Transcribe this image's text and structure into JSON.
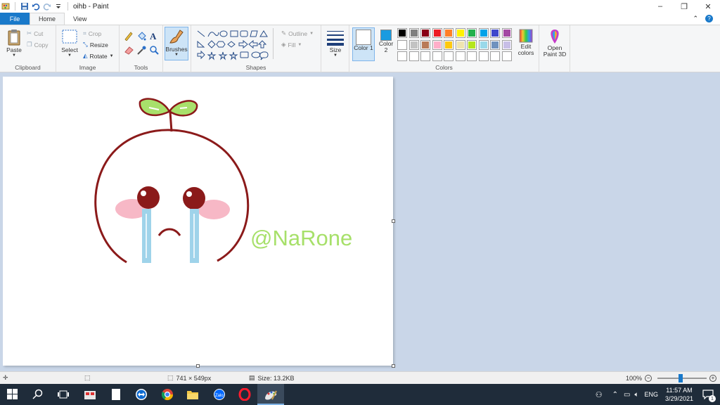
{
  "window": {
    "title": "oihb - Paint",
    "controls": {
      "minimize": "–",
      "restore": "❐",
      "close": "✕"
    }
  },
  "tabs": [
    {
      "label": "File"
    },
    {
      "label": "Home"
    },
    {
      "label": "View"
    }
  ],
  "ribbon_right": {
    "collapse": "⌃",
    "help": "?"
  },
  "clipboard": {
    "paste": "Paste",
    "cut": "Cut",
    "copy": "Copy",
    "label": "Clipboard"
  },
  "image": {
    "select": "Select",
    "crop": "Crop",
    "resize": "Resize",
    "rotate": "Rotate",
    "label": "Image"
  },
  "tools": {
    "label": "Tools"
  },
  "brushes": {
    "label": "Brushes"
  },
  "shapes": {
    "outline": "Outline",
    "fill": "Fill",
    "label": "Shapes"
  },
  "size": {
    "label": "Size"
  },
  "colors": {
    "color1": "Color 1",
    "color2": "Color 2",
    "edit": "Edit colors",
    "label": "Colors",
    "color1_value": "#ffffff",
    "color2_value": "#1a9be0",
    "palette_row1": [
      "#000000",
      "#7f7f7f",
      "#880015",
      "#ed1c24",
      "#ff7f27",
      "#fff200",
      "#22b14c",
      "#00a2e8",
      "#3f48cc",
      "#a349a4"
    ],
    "palette_row2": [
      "#ffffff",
      "#c3c3c3",
      "#b97a57",
      "#ffaec9",
      "#ffc90e",
      "#efe4b0",
      "#b5e61d",
      "#99d9ea",
      "#7092be",
      "#c8bfe7"
    ]
  },
  "paint3d": {
    "label": "Open Paint 3D"
  },
  "canvas": {
    "watermark": "@NaRone",
    "colors": {
      "outline": "#8b1a1a",
      "leaf": "#a8e06b",
      "blush": "#f7b8c6",
      "tears": "#9fd3ea"
    }
  },
  "statusbar": {
    "dimensions": "741 × 549px",
    "size": "Size: 13.2KB",
    "zoom": "100%"
  },
  "taskbar": {
    "language": "ENG",
    "time": "11:57 AM",
    "date": "3/29/2021",
    "notifications": "1"
  }
}
